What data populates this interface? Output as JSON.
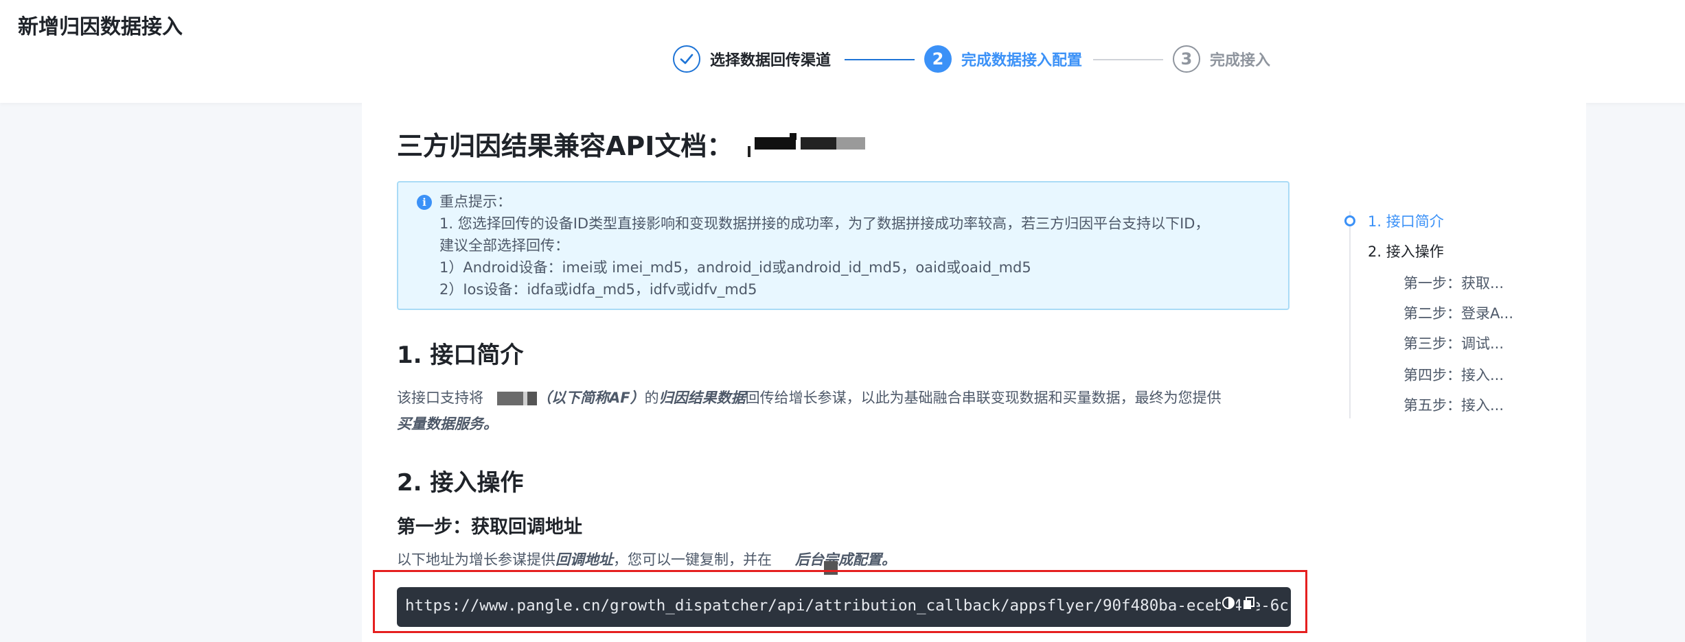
{
  "page": {
    "title": "新增归因数据接入"
  },
  "steps": [
    {
      "number": "",
      "label": "选择数据回传渠道",
      "state": "done"
    },
    {
      "number": "2",
      "label": "完成数据接入配置",
      "state": "active"
    },
    {
      "number": "3",
      "label": "完成接入",
      "state": "pending"
    }
  ],
  "doc": {
    "title": "三方归因结果兼容API文档：",
    "notice": {
      "lines": [
        "重点提示：",
        "1. 您选择回传的设备ID类型直接影响和变现数据拼接的成功率，为了数据拼接成功率较高，若三方归因平台支持以下ID，",
        "建议全部选择回传：",
        "1）Android设备：imei或 imei_md5，android_id或android_id_md5，oaid或oaid_md5",
        "2）Ios设备：idfa或idfa_md5，idfv或idfv_md5"
      ]
    },
    "section1": {
      "heading": "1. 接口简介",
      "para_prefix": "该接口支持将",
      "para_alias": "（以下简称AF）",
      "para_mid": "的",
      "para_bold": "归因结果数据",
      "para_rest": "回传给增长参谋，以此为基础融合串联变现数据和买量数据，最终为您提供",
      "para_line2": "买量数据服务。"
    },
    "section2": {
      "heading": "2. 接入操作",
      "step1_heading": "第一步：获取回调地址",
      "step1_prefix": "以下地址为增长参谋提供",
      "step1_bold": "回调地址",
      "step1_mid": "，您可以一键复制，并在",
      "step1_end": "后台完成配置。",
      "callback_url": "https://www.pangle.cn/growth_dispatcher/api/attribution_callback/appsflyer/90f480ba-eceb-47e-6c"
    }
  },
  "toc": [
    {
      "label": "1. 接口简介",
      "active": true
    },
    {
      "label": "2. 接入操作",
      "active": false
    },
    {
      "label": "第一步：获取...",
      "active": false
    },
    {
      "label": "第二步：登录A...",
      "active": false
    },
    {
      "label": "第三步：调试...",
      "active": false
    },
    {
      "label": "第四步：接入...",
      "active": false
    },
    {
      "label": "第五步：接入...",
      "active": false
    }
  ],
  "colors": {
    "primary": "#3b91f7",
    "done": "#1e74d6",
    "pending": "#8f959e",
    "highlight_border": "#e51f1f",
    "code_bg": "#2c333d"
  },
  "icons": {
    "step1": "check-icon",
    "notice": "info-icon",
    "copy": "copy-icon",
    "theme": "contrast-icon"
  }
}
